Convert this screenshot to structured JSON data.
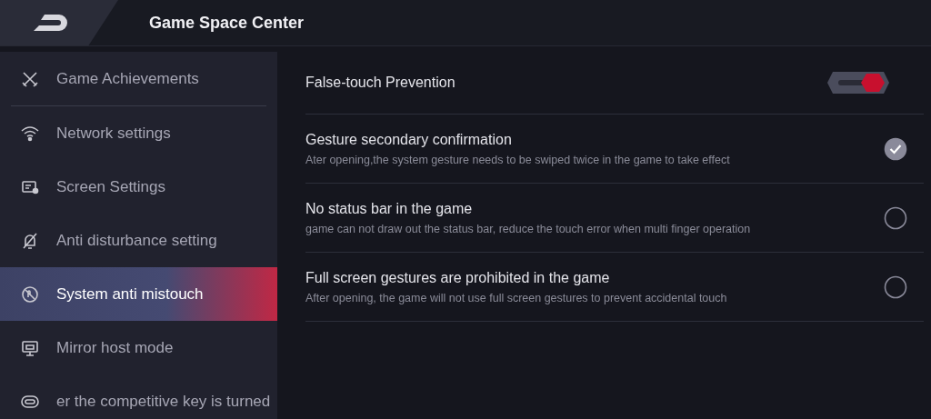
{
  "header": {
    "title": "Game Space Center"
  },
  "sidebar": {
    "items": [
      {
        "label": "Game Achievements",
        "selected": false
      },
      {
        "label": "Network settings",
        "selected": false
      },
      {
        "label": "Screen Settings",
        "selected": false
      },
      {
        "label": "Anti disturbance setting",
        "selected": false
      },
      {
        "label": "System anti mistouch",
        "selected": true
      },
      {
        "label": "Mirror host mode",
        "selected": false
      },
      {
        "label": "er the competitive key is turned",
        "selected": false
      }
    ]
  },
  "settings": [
    {
      "kind": "toggle",
      "title": "False-touch Prevention",
      "on": true
    },
    {
      "kind": "check",
      "title": "Gesture secondary confirmation",
      "description": "Ater opening,the system gesture needs to be swiped twice in the game to take effect",
      "checked": true
    },
    {
      "kind": "check",
      "title": "No status bar in the game",
      "description": "game can not draw out the status bar, reduce the touch error when multi finger operation",
      "checked": false
    },
    {
      "kind": "check",
      "title": "Full screen gestures are prohibited in the game",
      "description": "After opening, the game will not use full screen gestures to prevent accidental touch",
      "checked": false
    }
  ]
}
